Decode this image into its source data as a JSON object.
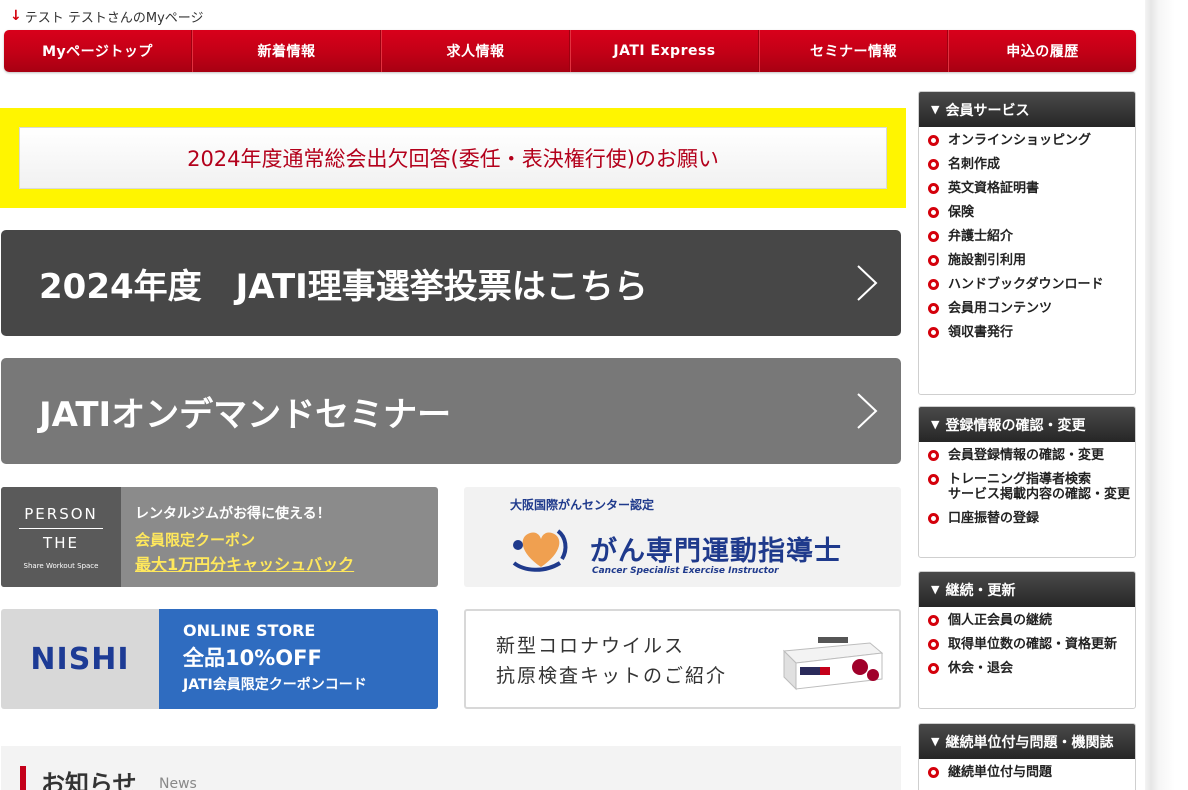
{
  "header": {
    "user_text": "テスト テストさんのMyページ",
    "nav": [
      "Myページトップ",
      "新着情報",
      "求人情報",
      "JATI Express",
      "セミナー情報",
      "申込の履歴"
    ]
  },
  "notice": {
    "label": "2024年度通常総会出欠回答(委任・表決権行使)のお願い",
    "bg_color": "#fff500",
    "text_color": "#b3001b"
  },
  "banners": {
    "election": "2024年度　JATI理事選挙投票はこちら",
    "ondemand": "JATIオンデマンドセミナー"
  },
  "ads": {
    "person": {
      "logo_line1": "PERSON",
      "logo_line2": "THE",
      "logo_small": "Share Workout Space",
      "line1": "レンタルジムがお得に使える！",
      "line2": "会員限定クーポン",
      "line3": "最大1万円分キャッシュバック"
    },
    "cancer": {
      "line1": "大阪国際がんセンター認定",
      "title": "がん専門運動指導士",
      "subtitle": "Cancer Specialist Exercise Instructor"
    },
    "nishi": {
      "brand": "NISHI",
      "line1": "ONLINE STORE",
      "line2": "全品10%OFF",
      "line3": "JATI会員限定クーポンコード"
    },
    "covid": {
      "line1": "新型コロナウイルス",
      "line2": "抗原検査キットのご紹介"
    }
  },
  "news": {
    "title": "お知らせ",
    "subtitle": "News"
  },
  "sidebar": {
    "sections": [
      {
        "title": "会員サービス",
        "items": [
          "オンラインショッピング",
          "名刺作成",
          "英文資格証明書",
          "保険",
          "弁護士紹介",
          "施設割引利用",
          "ハンドブックダウンロード",
          "会員用コンテンツ",
          "領収書発行"
        ]
      },
      {
        "title": "登録情報の確認・変更",
        "items": [
          "会員登録情報の確認・変更",
          "トレーニング指導者検索\nサービス掲載内容の確認・変更",
          "口座振替の登録"
        ]
      },
      {
        "title": "継続・更新",
        "items": [
          "個人正会員の継続",
          "取得単位数の確認・資格更新",
          "休会・退会"
        ]
      },
      {
        "title": "継続単位付与問題・機関誌",
        "items": [
          "継続単位付与問題"
        ]
      }
    ]
  }
}
